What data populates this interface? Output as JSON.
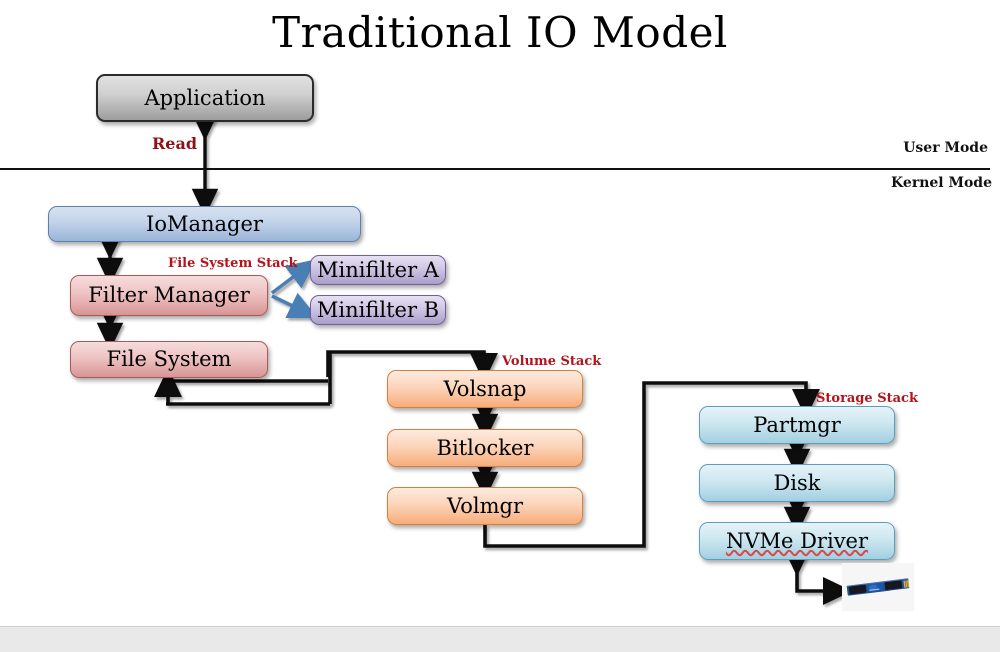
{
  "slide": {
    "title": "Traditional IO Model",
    "background": "#ffffff",
    "footer_color": "#e9e9e9"
  },
  "mode_divider": {
    "user_mode_label": "User Mode",
    "kernel_mode_label": "Kernel Mode"
  },
  "labels": {
    "read": "Read",
    "read_color": "#8f1118",
    "file_system_stack": "File System Stack",
    "volume_stack": "Volume Stack",
    "storage_stack": "Storage Stack",
    "stack_caption_color": "#b3131b"
  },
  "nodes": {
    "application": {
      "label": "Application",
      "style": "grey",
      "color": "#cfcfcf"
    },
    "iomanager": {
      "label": "IoManager",
      "style": "bluegrey",
      "color": "#c2d3e9"
    },
    "filter_manager": {
      "label": "Filter Manager",
      "style": "pink",
      "color": "#eec3c3"
    },
    "file_system": {
      "label": "File System",
      "style": "pink",
      "color": "#eec3c3"
    },
    "minifilter_a": {
      "label": "Minifilter A",
      "style": "purple",
      "color": "#cfc6e4"
    },
    "minifilter_b": {
      "label": "Minifilter B",
      "style": "purple",
      "color": "#cfc6e4"
    },
    "volsnap": {
      "label": "Volsnap",
      "style": "orange",
      "color": "#fcd5bb"
    },
    "bitlocker": {
      "label": "Bitlocker",
      "style": "orange",
      "color": "#fcd5bb"
    },
    "volmgr": {
      "label": "Volmgr",
      "style": "orange",
      "color": "#fcd5bb"
    },
    "partmgr": {
      "label": "Partmgr",
      "style": "ltblue",
      "color": "#cde7f0"
    },
    "disk": {
      "label": "Disk",
      "style": "ltblue",
      "color": "#cde7f0"
    },
    "nvme_driver": {
      "label": "NVMe Driver",
      "style": "ltblue",
      "color": "#cde7f0",
      "misspelled": true
    }
  },
  "device": {
    "name": "nvme-ssd-photo",
    "description": "M.2 NVMe SSD"
  },
  "connector_colors": {
    "black": "#111111",
    "blue": "#4a7fb5"
  }
}
